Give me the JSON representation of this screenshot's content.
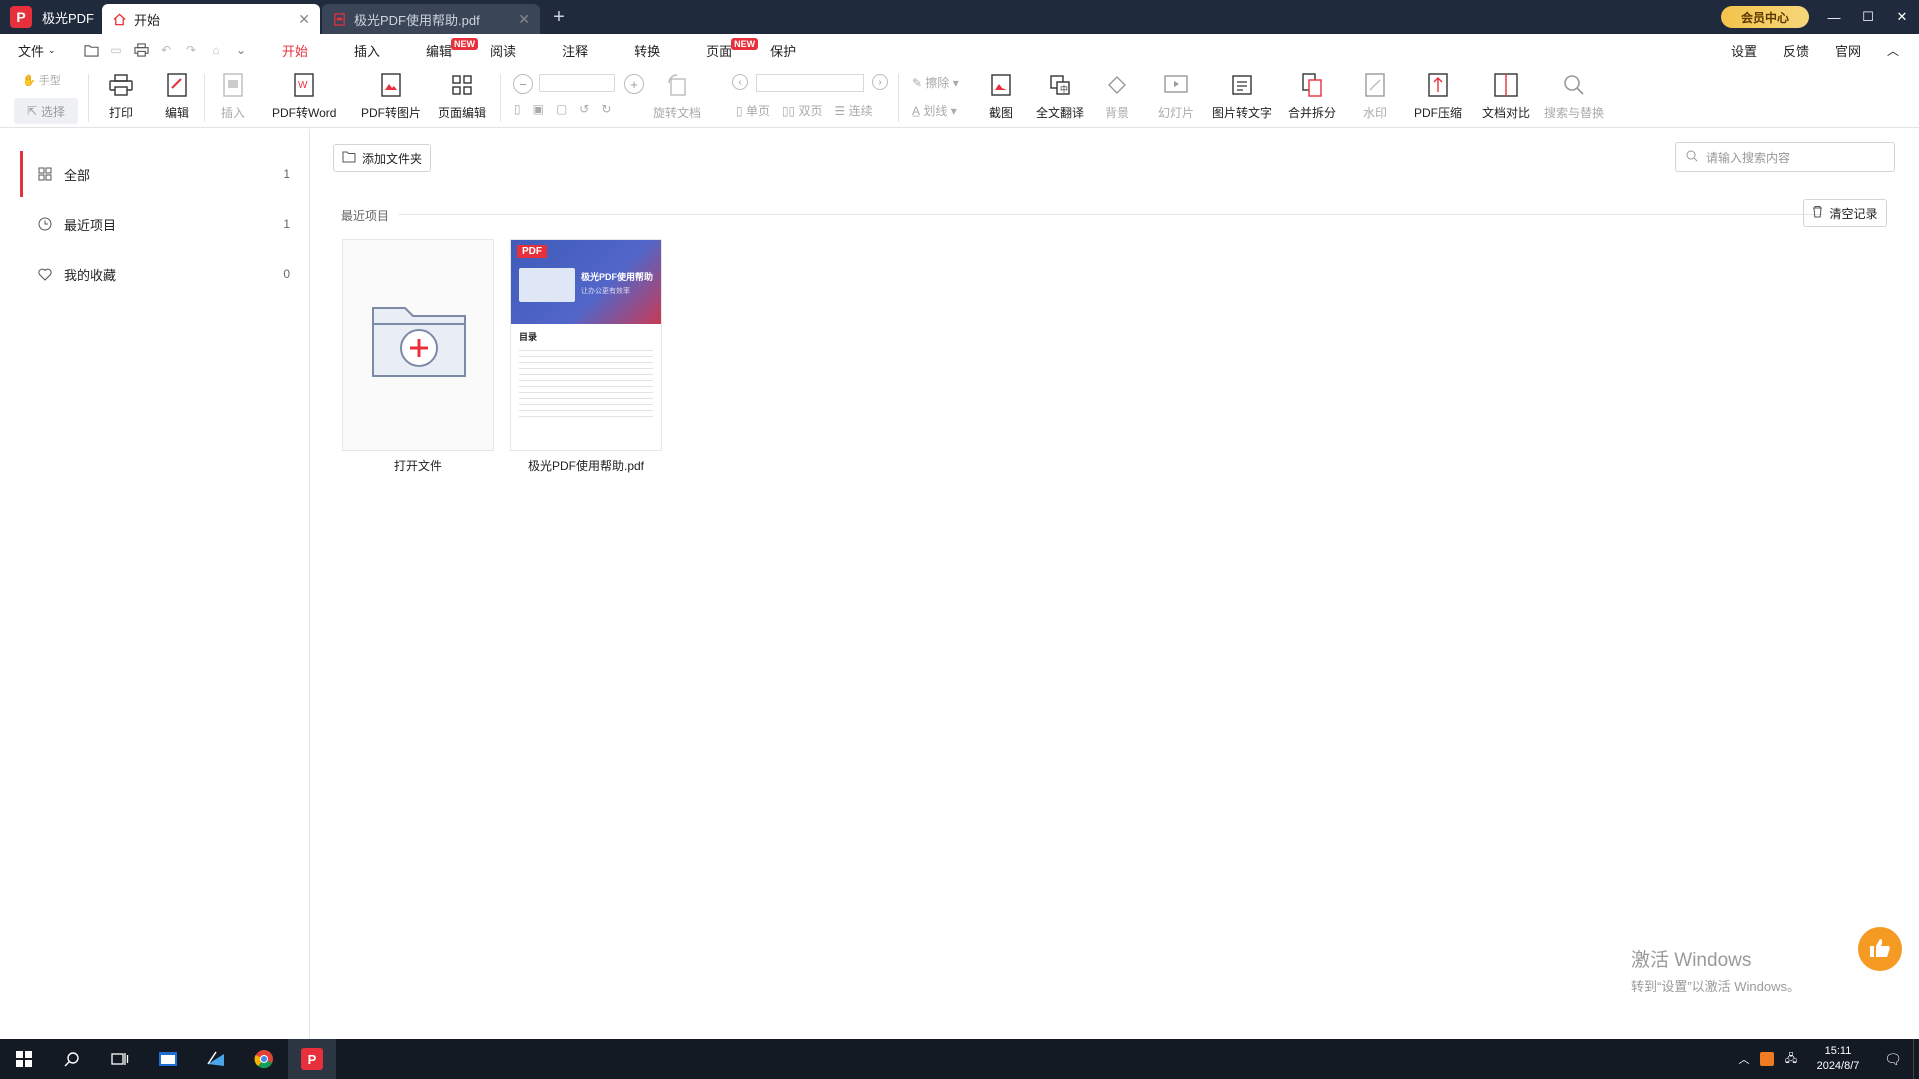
{
  "titlebar": {
    "app_name": "极光PDF",
    "tabs": [
      {
        "label": "开始",
        "active": true
      },
      {
        "label": "极光PDF使用帮助.pdf",
        "active": false
      }
    ],
    "vip_label": "会员中心"
  },
  "menubar": {
    "file": "文件",
    "items": [
      "开始",
      "插入",
      "编辑",
      "阅读",
      "注释",
      "转换",
      "页面",
      "保护"
    ],
    "new_badge": "NEW",
    "right": [
      "设置",
      "反馈",
      "官网"
    ]
  },
  "toolbar": {
    "hand": "手型",
    "select": "选择",
    "print": "打印",
    "edit": "编辑",
    "insert": "插入",
    "pdf_to_word": "PDF转Word",
    "pdf_to_image": "PDF转图片",
    "page_edit": "页面编辑",
    "rotate_doc": "旋转文档",
    "single": "单页",
    "double": "双页",
    "continuous": "连续",
    "erase": "擦除",
    "underline": "划线",
    "screenshot": "截图",
    "translate": "全文翻译",
    "background": "背景",
    "slideshow": "幻灯片",
    "img_to_text": "图片转文字",
    "merge_split": "合并拆分",
    "watermark": "水印",
    "compress": "PDF压缩",
    "compare": "文档对比",
    "search_replace": "搜索与替换"
  },
  "sidebar": {
    "items": [
      {
        "label": "全部",
        "count": "1"
      },
      {
        "label": "最近项目",
        "count": "1"
      },
      {
        "label": "我的收藏",
        "count": "0"
      }
    ]
  },
  "main": {
    "add_folder": "添加文件夹",
    "search_placeholder": "请输入搜索内容",
    "section_title": "最近项目",
    "clear_records": "清空记录",
    "open_file": "打开文件",
    "file_name": "极光PDF使用帮助.pdf",
    "cover": {
      "badge": "PDF",
      "title": "极光PDF使用帮助",
      "subtitle": "让办公更有效率",
      "toc": "目录"
    }
  },
  "watermark": {
    "line1": "激活 Windows",
    "line2": "转到“设置”以激活 Windows。"
  },
  "taskbar": {
    "time": "15:11",
    "date": "2024/8/7"
  },
  "colors": {
    "accent": "#e8303c",
    "titlebar": "#1f2b3d",
    "like": "#f59a23"
  }
}
